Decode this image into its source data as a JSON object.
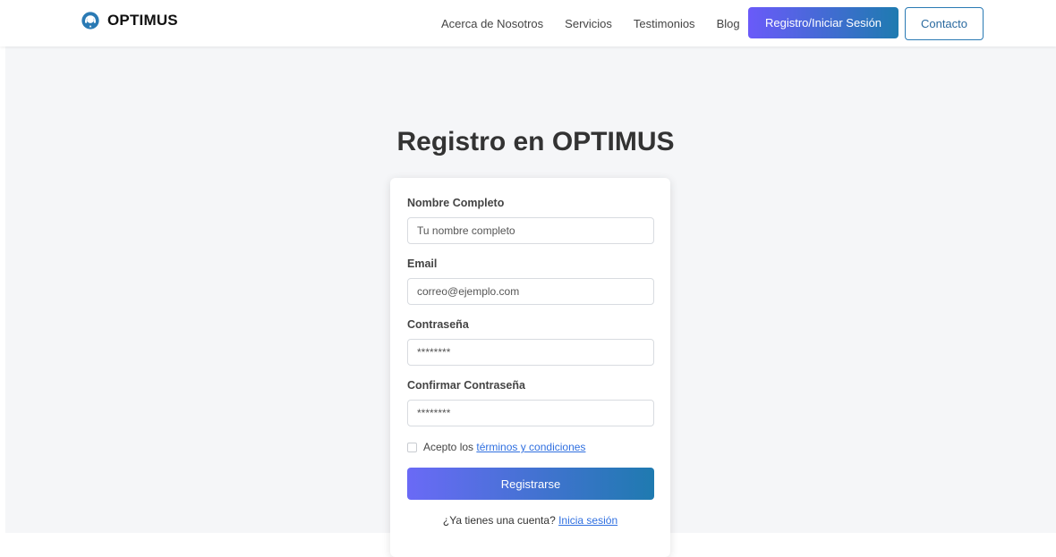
{
  "brand": {
    "name": "OPTIMUS",
    "icon": "headset-icon",
    "icon_color": "#2a7ab4"
  },
  "nav": {
    "links": [
      "Acerca de Nosotros",
      "Servicios",
      "Testimonios",
      "Blog"
    ],
    "login_button": "Registro/Iniciar Sesión",
    "contact_button": "Contacto"
  },
  "colors": {
    "accent_start": "#6a5af9",
    "accent_end": "#1e7bb0",
    "link": "#2f6fe0",
    "background": "#f5f6f8"
  },
  "page": {
    "title": "Registro en OPTIMUS"
  },
  "form": {
    "full_name": {
      "label": "Nombre Completo",
      "placeholder": "Tu nombre completo"
    },
    "email": {
      "label": "Email",
      "placeholder": "correo@ejemplo.com"
    },
    "password": {
      "label": "Contraseña",
      "placeholder": "********"
    },
    "confirm_password": {
      "label": "Confirmar Contraseña",
      "placeholder": "********"
    },
    "terms": {
      "prefix": "Acepto los ",
      "link": "términos y condiciones",
      "checked": false
    },
    "submit": "Registrarse",
    "login_prompt": {
      "text": "¿Ya tienes una cuenta? ",
      "link": "Inicia sesión"
    }
  }
}
